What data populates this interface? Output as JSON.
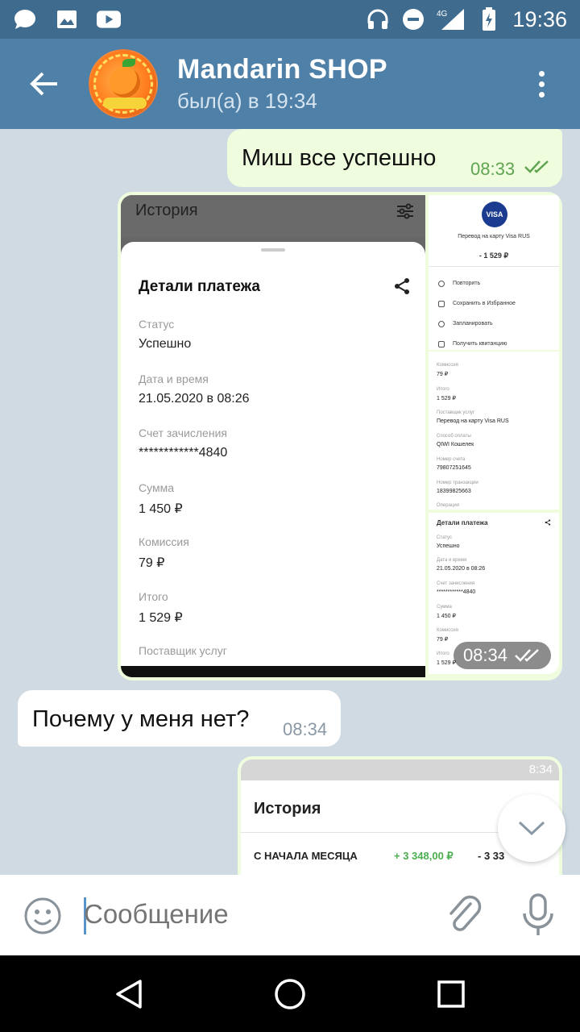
{
  "status_bar": {
    "time": "19:36",
    "network": "4G",
    "icons": [
      "message-icon",
      "image-icon",
      "youtube-icon",
      "headphones-icon",
      "dnd-icon",
      "signal-icon",
      "battery-icon"
    ]
  },
  "header": {
    "title": "Mandarin SHOP",
    "subtitle": "был(а) в 19:34",
    "avatar_text": [
      "MANDARIN",
      "SHOP"
    ]
  },
  "messages": {
    "out1": {
      "text": "Миш все успешно",
      "time": "08:33"
    },
    "album_time": "08:34",
    "in1": {
      "text": "Почему у меня нет?",
      "time": "08:34"
    }
  },
  "screenshot_main": {
    "top_title": "История",
    "sheet_title": "Детали платежа",
    "fields": [
      {
        "label": "Статус",
        "value": "Успешно"
      },
      {
        "label": "Дата и время",
        "value": "21.05.2020 в 08:26"
      },
      {
        "label": "Счет зачисления",
        "value": "************4840"
      },
      {
        "label": "Сумма",
        "value": "1 450 ₽"
      },
      {
        "label": "Комиссия",
        "value": "79 ₽"
      },
      {
        "label": "Итого",
        "value": "1 529 ₽"
      },
      {
        "label": "Поставщик услуг",
        "value": ""
      }
    ]
  },
  "screenshot_visa": {
    "logo": "VISA",
    "line1": "Перевод на карту Visa RUS",
    "amount": "- 1 529 ₽",
    "actions": [
      "Повторить",
      "Сохранить в Избранное",
      "Запланировать",
      "Получить квитанцию"
    ]
  },
  "screenshot_details": {
    "items": [
      {
        "label": "Комиссия",
        "value": "79 ₽"
      },
      {
        "label": "Итого",
        "value": "1 529 ₽"
      },
      {
        "label": "Поставщик услуг",
        "value": "Перевод на карту Visa RUS"
      },
      {
        "label": "Способ оплаты",
        "value": "QIWI Кошелек"
      },
      {
        "label": "Номер счета",
        "value": "79807251645"
      },
      {
        "label": "Номер транзакции",
        "value": "18399825663"
      },
      {
        "label": "Операция",
        "value": ""
      }
    ]
  },
  "screenshot_small_sheet": {
    "title": "Детали платежа",
    "items": [
      {
        "label": "Статус",
        "value": "Успешно"
      },
      {
        "label": "Дата и время",
        "value": "21.05.2020 в 08:26"
      },
      {
        "label": "Счет зачисления",
        "value": "************4840"
      },
      {
        "label": "Сумма",
        "value": "1 450 ₽"
      },
      {
        "label": "Комиссия",
        "value": "79 ₽"
      },
      {
        "label": "Итого",
        "value": "1 529 ₽"
      }
    ]
  },
  "screenshot_history": {
    "status_time": "8:34",
    "title": "История",
    "row_label": "С НАЧАЛА МЕСЯЦА",
    "income": "+ 3 348,00 ₽",
    "expense": "- 3 33"
  },
  "input": {
    "placeholder": "Сообщение"
  },
  "colors": {
    "header": "#4f80a8",
    "status_bar": "#3f6b8f",
    "out_bubble": "#effdde",
    "in_bubble": "#ffffff",
    "out_time": "#5fa551"
  }
}
